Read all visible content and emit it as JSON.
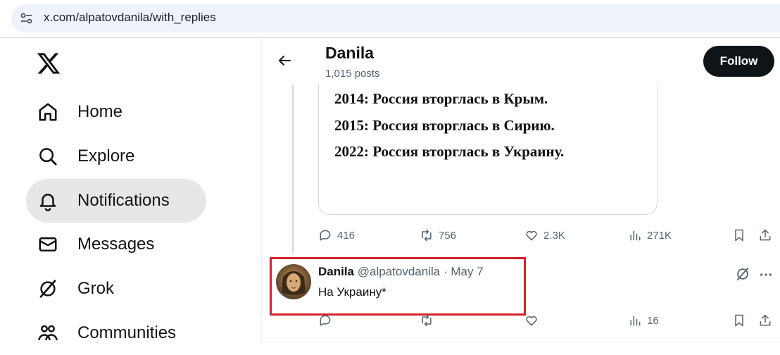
{
  "browser": {
    "url": "x.com/alpatovdanila/with_replies"
  },
  "nav": {
    "items": [
      {
        "label": "Home",
        "icon": "home-icon"
      },
      {
        "label": "Explore",
        "icon": "search-icon"
      },
      {
        "label": "Notifications",
        "icon": "bell-icon",
        "active": true
      },
      {
        "label": "Messages",
        "icon": "mail-icon"
      },
      {
        "label": "Grok",
        "icon": "grok-icon"
      },
      {
        "label": "Communities",
        "icon": "communities-icon"
      }
    ]
  },
  "header": {
    "name": "Danila",
    "posts": "1,015 posts",
    "follow_label": "Follow"
  },
  "media_post": {
    "lines": [
      "2014: Россия вторглась в Крым.",
      "2015: Россия вторглась в Сирию.",
      "2022: Россия вторглась в Украину."
    ],
    "replies": "416",
    "reposts": "756",
    "likes": "2.3K",
    "views": "271K"
  },
  "reply_post": {
    "name": "Danila",
    "handle": "@alpatovdanila",
    "separator": "·",
    "date": "May 7",
    "text": "На Украину*",
    "views": "16"
  },
  "colors": {
    "accent": "#0f1419",
    "highlight": "#d0232a",
    "muted": "#536471"
  }
}
